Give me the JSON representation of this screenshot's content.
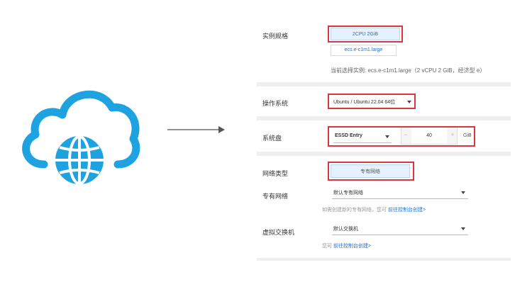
{
  "form": {
    "instance_spec": {
      "label": "实例规格",
      "selected": "2CPU 2GiB",
      "sub_option": "ecs.e-c1m1.large",
      "current": "当前选择实例: ecs.e-c1m1.large（2 vCPU 2 GiB，经济型 e）"
    },
    "os": {
      "label": "操作系统",
      "value": "Ubuntu / Ubuntu 22.04 64位"
    },
    "system_disk": {
      "label": "系统盘",
      "type": "ESSD Entry",
      "decrement": "−",
      "size": "40",
      "increment": "+",
      "unit": "GiB"
    },
    "network_type": {
      "label": "网络类型",
      "selected": "专有网络"
    },
    "vpc": {
      "label": "专有网络",
      "value": "默认专有网络",
      "hint": "如需创建新的专有网络，您可",
      "hint_link": "前往控制台创建>"
    },
    "vswitch": {
      "label": "虚拟交换机",
      "value": "默认交换机",
      "hint": "您可",
      "hint_link": "前往控制台创建>"
    }
  },
  "colors": {
    "highlight": "#d9363e",
    "accent": "#1f6fd1",
    "cloud": "#1fa3e0"
  }
}
